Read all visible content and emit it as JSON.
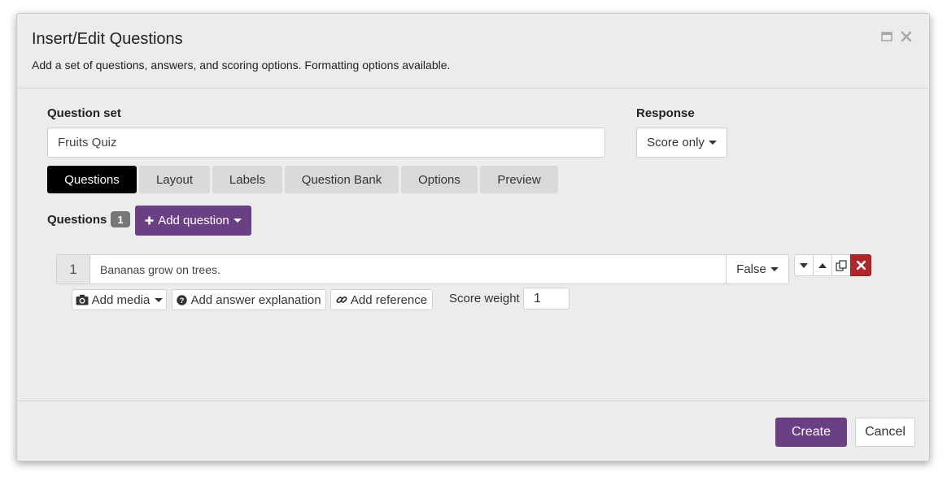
{
  "dialog": {
    "title": "Insert/Edit Questions",
    "subtitle": "Add a set of questions, answers, and scoring options. Formatting options available.",
    "window_icons": [
      "maximize-icon",
      "close-icon"
    ]
  },
  "question_set": {
    "label": "Question set",
    "value": "Fruits Quiz"
  },
  "response": {
    "label": "Response",
    "selected": "Score only"
  },
  "tabs": [
    {
      "label": "Questions",
      "active": true
    },
    {
      "label": "Layout",
      "active": false
    },
    {
      "label": "Labels",
      "active": false
    },
    {
      "label": "Question Bank",
      "active": false
    },
    {
      "label": "Options",
      "active": false
    },
    {
      "label": "Preview",
      "active": false
    }
  ],
  "questions_section": {
    "label": "Questions",
    "count": "1",
    "add_button": "Add question"
  },
  "question_rows": [
    {
      "number": "1",
      "text": "Bananas grow on trees.",
      "answer": "False",
      "actions": {
        "add_media": "Add media",
        "add_explanation": "Add answer explanation",
        "add_reference": "Add reference"
      },
      "score_weight_label": "Score weight",
      "score_weight": "1"
    }
  ],
  "footer": {
    "create": "Create",
    "cancel": "Cancel"
  },
  "colors": {
    "accent": "#6b3f83",
    "active_tab": "#000000",
    "delete": "#b0262a",
    "dialog_bg": "#ececec"
  }
}
